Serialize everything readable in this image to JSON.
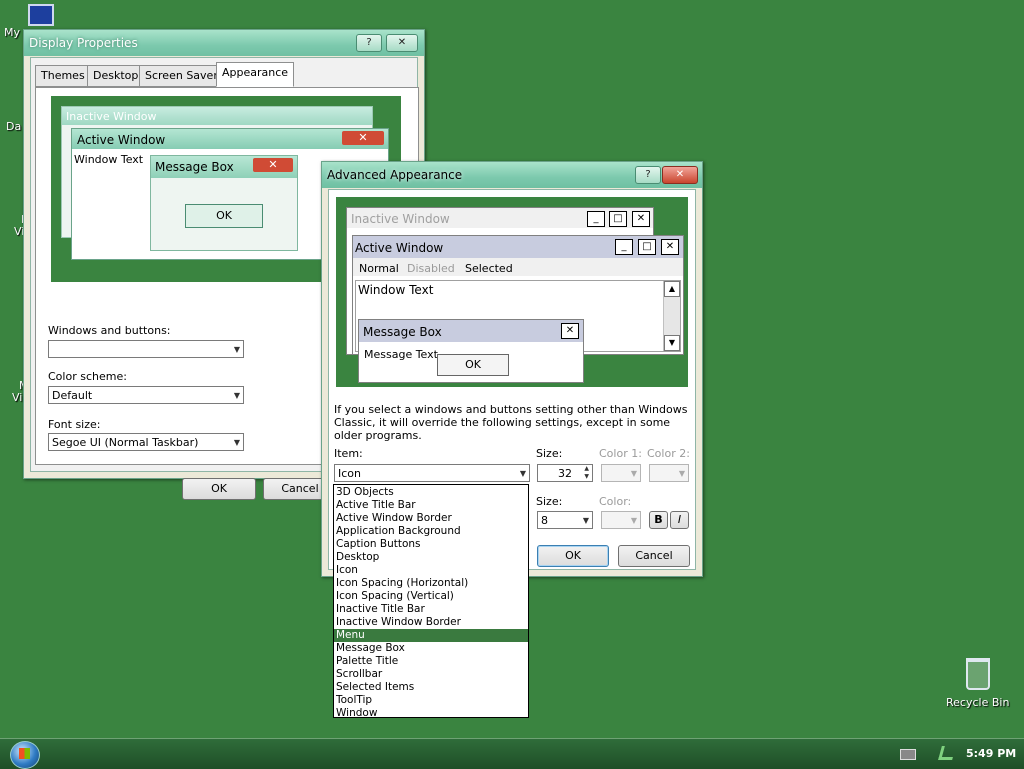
{
  "desktop": {
    "icons": [
      {
        "label": "My",
        "icon": "computer-icon"
      },
      {
        "label": "Da",
        "icon": "folder-icon"
      },
      {
        "label": "M\nVi",
        "icon": "folder-icon"
      },
      {
        "label": "M\nVi",
        "icon": "folder-icon"
      },
      {
        "label": "Recycle Bin",
        "icon": "recycle-bin-icon"
      }
    ],
    "background_color": "#3a8440"
  },
  "display_properties": {
    "title": "Display Properties",
    "help_btn": "?",
    "close_btn": "✕",
    "tabs": [
      "Themes",
      "Desktop",
      "Screen Saver",
      "Appearance"
    ],
    "selected_tab": "Appearance",
    "preview": {
      "inactive_title": "Inactive Window",
      "active_title": "Active Window",
      "window_text": "Window Text",
      "message_box_title": "Message Box",
      "ok": "OK"
    },
    "windows_and_buttons_label": "Windows and buttons:",
    "windows_and_buttons_value": "",
    "color_scheme_label": "Color scheme:",
    "color_scheme_value": "Default",
    "font_size_label": "Font size:",
    "font_size_value": "Segoe UI (Normal Taskbar)",
    "ok": "OK",
    "cancel": "Cancel"
  },
  "advanced_appearance": {
    "title": "Advanced Appearance",
    "help_btn": "?",
    "close_btn": "✕",
    "preview": {
      "inactive_title": "Inactive Window",
      "active_title": "Active Window",
      "menu_normal": "Normal",
      "menu_disabled": "Disabled",
      "menu_selected": "Selected",
      "window_text": "Window Text",
      "message_box_title": "Message Box",
      "message_text": "Message Text",
      "ok": "OK"
    },
    "notice": "If you select a windows and buttons setting other than Windows Classic, it will override the following settings, except in some older programs.",
    "item_label": "Item:",
    "item_value": "Icon",
    "size_label": "Size:",
    "size_value": "32",
    "color1_label": "Color 1:",
    "color2_label": "Color 2:",
    "font_label": "",
    "font_size_label": "Size:",
    "font_size_value": "8",
    "font_color_label": "Color:",
    "bold": "B",
    "italic": "I",
    "ok": "OK",
    "cancel": "Cancel",
    "item_options": [
      "3D Objects",
      "Active Title Bar",
      "Active Window Border",
      "Application Background",
      "Caption Buttons",
      "Desktop",
      "Icon",
      "Icon Spacing (Horizontal)",
      "Icon Spacing (Vertical)",
      "Inactive Title Bar",
      "Inactive Window Border",
      "Menu",
      "Message Box",
      "Palette Title",
      "Scrollbar",
      "Selected Items",
      "ToolTip",
      "Window"
    ],
    "highlighted_option": "Menu"
  },
  "taskbar": {
    "clock": "5:49 PM"
  }
}
